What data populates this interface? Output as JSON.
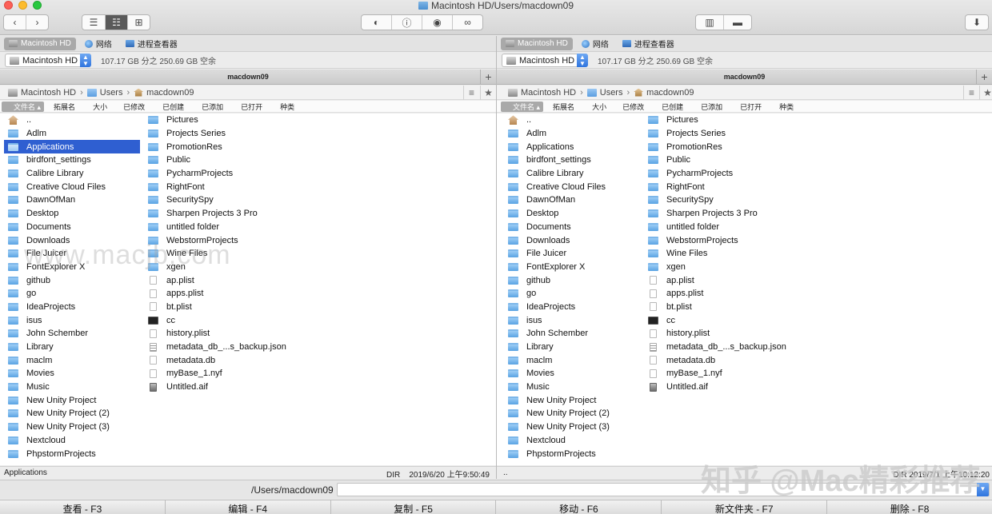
{
  "window": {
    "title": "Macintosh HD/Users/macdown09"
  },
  "icons": {
    "view_list": "list-icon",
    "view_detail": "detail-list-icon",
    "view_grid": "grid-icon",
    "toggle": "toggle-icon",
    "info": "info-icon",
    "preview": "eye-icon",
    "binoculars": "binoculars-icon",
    "compress": "archive-icon",
    "folder": "folder-icon",
    "download": "download-icon"
  },
  "tabs": [
    "Macintosh HD",
    "网络",
    "进程查看器"
  ],
  "disk": {
    "selected": "Macintosh HD",
    "info": "107.17 GB 分之 250.69 GB 空余"
  },
  "panel_title": "macdown09",
  "breadcrumb": [
    "Macintosh HD",
    "Users",
    "macdown09"
  ],
  "columns": [
    "文件名",
    "拓展名",
    "大小",
    "已修改",
    "已创建",
    "已添加",
    "已打开",
    "种类"
  ],
  "left": {
    "col1": [
      "..",
      "Adlm",
      "Applications",
      "birdfont_settings",
      "Calibre Library",
      "Creative Cloud Files",
      "DawnOfMan",
      "Desktop",
      "Documents",
      "Downloads",
      "File Juicer",
      "FontExplorer X",
      "github",
      "go",
      "IdeaProjects",
      "isus",
      "John Schember",
      "Library",
      "maclm",
      "Movies",
      "Music",
      "New Unity Project",
      "New Unity Project (2)",
      "New Unity Project (3)",
      "Nextcloud",
      "PhpstormProjects"
    ],
    "col2": [
      "Pictures",
      "Projects Series",
      "PromotionRes",
      "Public",
      "PycharmProjects",
      "RightFont",
      "SecuritySpy",
      "Sharpen Projects 3 Pro",
      "untitled folder",
      "WebstormProjects",
      "Wine Files",
      "xgen",
      "ap.plist",
      "apps.plist",
      "bt.plist",
      "cc",
      "history.plist",
      "metadata_db_...s_backup.json",
      "metadata.db",
      "myBase_1.nyf",
      "Untitled.aif"
    ],
    "status_name": "Applications",
    "status_kind": "DIR",
    "status_date": "2019/6/20 上午9:50:49"
  },
  "right": {
    "status_name": "..",
    "status_right": "DIR 2019/7/1 上午10:12:20"
  },
  "cmd": {
    "cwd": "/Users/macdown09"
  },
  "fkeys": [
    "查看 - F3",
    "编辑 - F4",
    "复制 - F5",
    "移动 - F6",
    "新文件夹 - F7",
    "删除 - F8"
  ],
  "watermarks": [
    "www.macjb.com",
    "知乎 @Mac精彩推荐"
  ]
}
